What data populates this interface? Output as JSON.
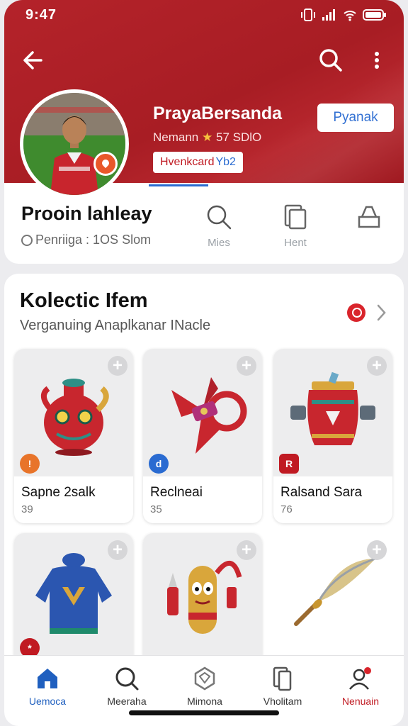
{
  "status_bar": {
    "time": "9:47"
  },
  "header": {
    "profile_name": "PrayaBersanda",
    "meta_prefix": "Nemann",
    "meta_rating": "57 SDlO",
    "tag_label": "Hvenkcard",
    "tag_code": "Yb2",
    "follow_label": "Pyanak"
  },
  "stats": {
    "title": "Prooin lahleay",
    "subtitle": "Penriiga : 1OS Slom",
    "actions": [
      {
        "label": "Mies",
        "icon": "search-icon"
      },
      {
        "label": "Hent",
        "icon": "folder-icon"
      },
      {
        "label": "",
        "icon": "bag-icon"
      }
    ]
  },
  "collection": {
    "title": "Kolectic Ifem",
    "subtitle": "Verganuing Anaplkanar INacle",
    "items": [
      {
        "name": "Sapne 2salk",
        "count": "39",
        "badge_color": "#e8742a",
        "badge_text": "!",
        "icon": "vase-icon"
      },
      {
        "name": "Reclneai",
        "count": "35",
        "badge_color": "#2a6bd1",
        "badge_text": "d",
        "icon": "weapon-icon"
      },
      {
        "name": "Ralsand Sara",
        "count": "76",
        "badge_color": "#c01a22",
        "badge_text": "R",
        "icon": "urn-icon"
      },
      {
        "name": "",
        "count": "",
        "badge_color": "#c01a22",
        "badge_text": "*",
        "icon": "jacket-icon"
      },
      {
        "name": "",
        "count": "",
        "badge_color": "",
        "badge_text": "",
        "icon": "figure-icon"
      },
      {
        "name": "",
        "count": "",
        "badge_color": "",
        "badge_text": "",
        "icon": "feather-icon"
      }
    ]
  },
  "bottom_nav": [
    {
      "label": "Uemoca",
      "icon": "home-icon"
    },
    {
      "label": "Meeraha",
      "icon": "search-icon"
    },
    {
      "label": "Mimona",
      "icon": "gem-icon"
    },
    {
      "label": "Vholitam",
      "icon": "phone-icon"
    },
    {
      "label": "Nenuain",
      "icon": "user-icon"
    }
  ],
  "colors": {
    "brand_red": "#b4232a",
    "accent_blue": "#2a6bd1"
  }
}
